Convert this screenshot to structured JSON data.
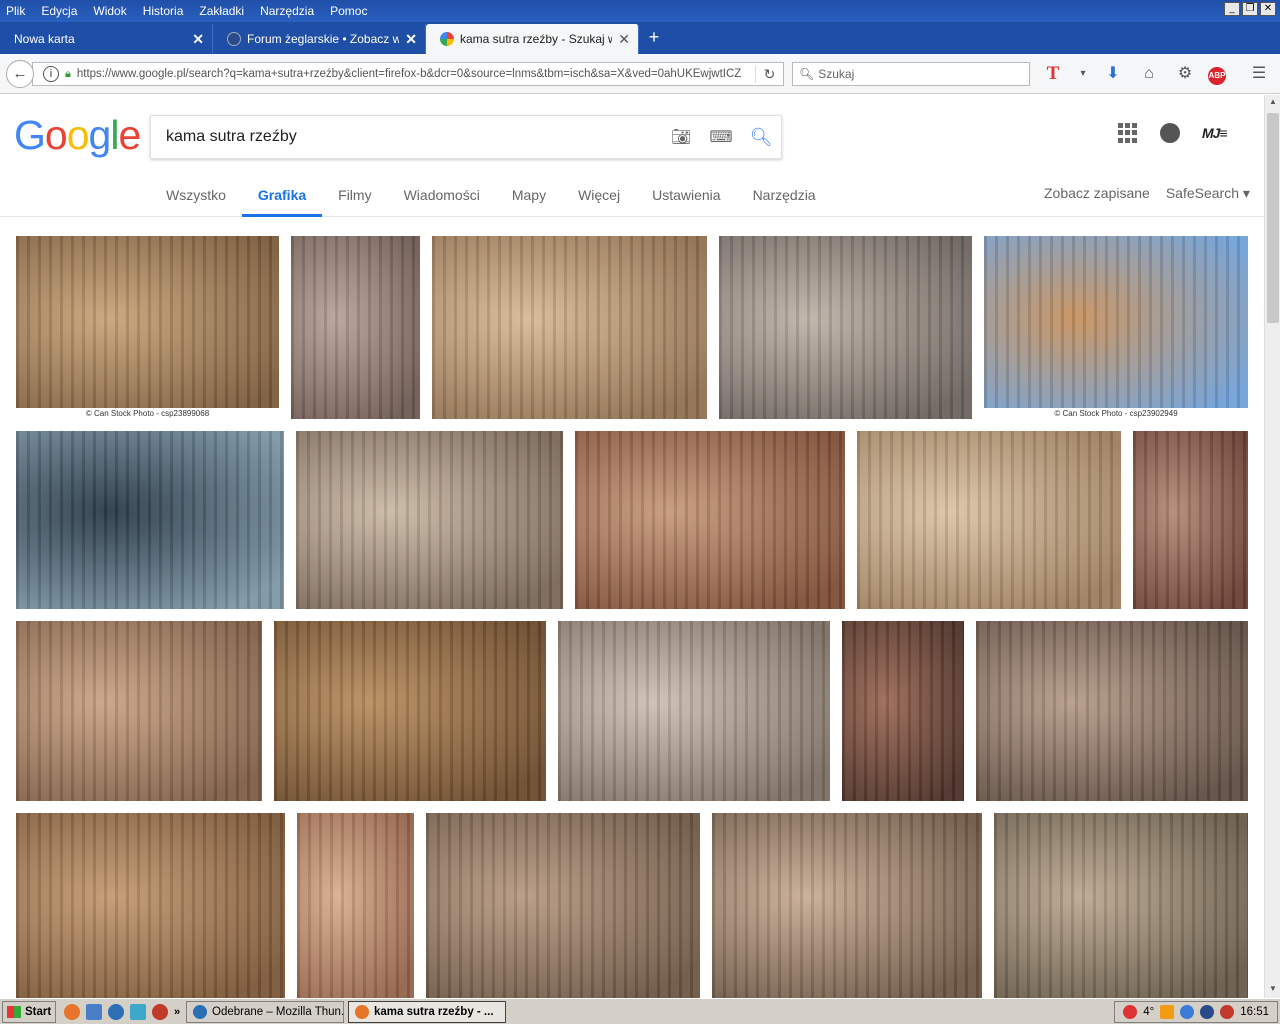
{
  "menubar": {
    "items": [
      "Plik",
      "Edycja",
      "Widok",
      "Historia",
      "Zakładki",
      "Narzędzia",
      "Pomoc"
    ]
  },
  "tabs": [
    {
      "title": "Nowa karta",
      "active": false
    },
    {
      "title": "Forum żeglarskie • Zobacz wą...",
      "active": false
    },
    {
      "title": "kama sutra rzeźby - Szukaj w ...",
      "active": true
    }
  ],
  "navbar": {
    "url": "https://www.google.pl/search?q=kama+sutra+rzeźby&client=firefox-b&dcr=0&source=lnms&tbm=isch&sa=X&ved=0ahUKEwjwtICZ",
    "search_placeholder": "Szukaj"
  },
  "google": {
    "logo_letters": [
      "G",
      "o",
      "o",
      "g",
      "l",
      "e"
    ],
    "logo_colors": [
      "#4285f4",
      "#ea4335",
      "#fbbc05",
      "#4285f4",
      "#34a853",
      "#ea4335"
    ],
    "query": "kama sutra rzeźby",
    "tabs": [
      "Wszystko",
      "Grafika",
      "Filmy",
      "Wiadomości",
      "Mapy",
      "Więcej",
      "Ustawienia",
      "Narzędzia"
    ],
    "active_tab": "Grafika",
    "saved": "Zobacz zapisane",
    "safesearch": "SafeSearch ▾"
  },
  "results": {
    "captions": [
      "© Can Stock Photo - csp23899068",
      "© Can Stock Photo - csp23902949"
    ],
    "images": [
      {
        "row": 0,
        "c1": "#c9a57a",
        "c2": "#7a5a3b",
        "caption": 0
      },
      {
        "row": 0,
        "c1": "#b9a39a",
        "c2": "#6d5a52"
      },
      {
        "row": 0,
        "c1": "#d7b996",
        "c2": "#8f6f4f"
      },
      {
        "row": 0,
        "c1": "#bfb3a8",
        "c2": "#6b625c"
      },
      {
        "row": 0,
        "c1": "#c8925e",
        "c2": "#6fa0d8",
        "caption": 1
      },
      {
        "row": 1,
        "c1": "#2a3a48",
        "c2": "#7d95a3"
      },
      {
        "row": 1,
        "c1": "#cbb9a6",
        "c2": "#786656"
      },
      {
        "row": 1,
        "c1": "#c79a7c",
        "c2": "#7d4e36"
      },
      {
        "row": 1,
        "c1": "#dbc4a6",
        "c2": "#9c7d5d"
      },
      {
        "row": 1,
        "c1": "#b68a78",
        "c2": "#6a3f33"
      },
      {
        "row": 2,
        "c1": "#caa486",
        "c2": "#7e5d45"
      },
      {
        "row": 2,
        "c1": "#b98e60",
        "c2": "#6b4a2c"
      },
      {
        "row": 2,
        "c1": "#cdbfb2",
        "c2": "#7b6d63"
      },
      {
        "row": 2,
        "c1": "#9c6a56",
        "c2": "#4a3027"
      },
      {
        "row": 2,
        "c1": "#b59c8a",
        "c2": "#5f4d42"
      },
      {
        "row": 3,
        "c1": "#c49a72",
        "c2": "#7a5637"
      },
      {
        "row": 3,
        "c1": "#d9ae8e",
        "c2": "#92634a"
      },
      {
        "row": 3,
        "c1": "#b79b83",
        "c2": "#6c5645"
      },
      {
        "row": 3,
        "c1": "#c8ad95",
        "c2": "#6d5746"
      },
      {
        "row": 3,
        "c1": "#bba891",
        "c2": "#665948"
      }
    ]
  },
  "taskbar": {
    "start": "Start",
    "tasks": [
      {
        "label": "Odebrane – Mozilla Thun...",
        "active": false
      },
      {
        "label": "kama sutra rzeźby - ...",
        "active": true
      }
    ],
    "temp": "4°",
    "time": "16:51"
  }
}
